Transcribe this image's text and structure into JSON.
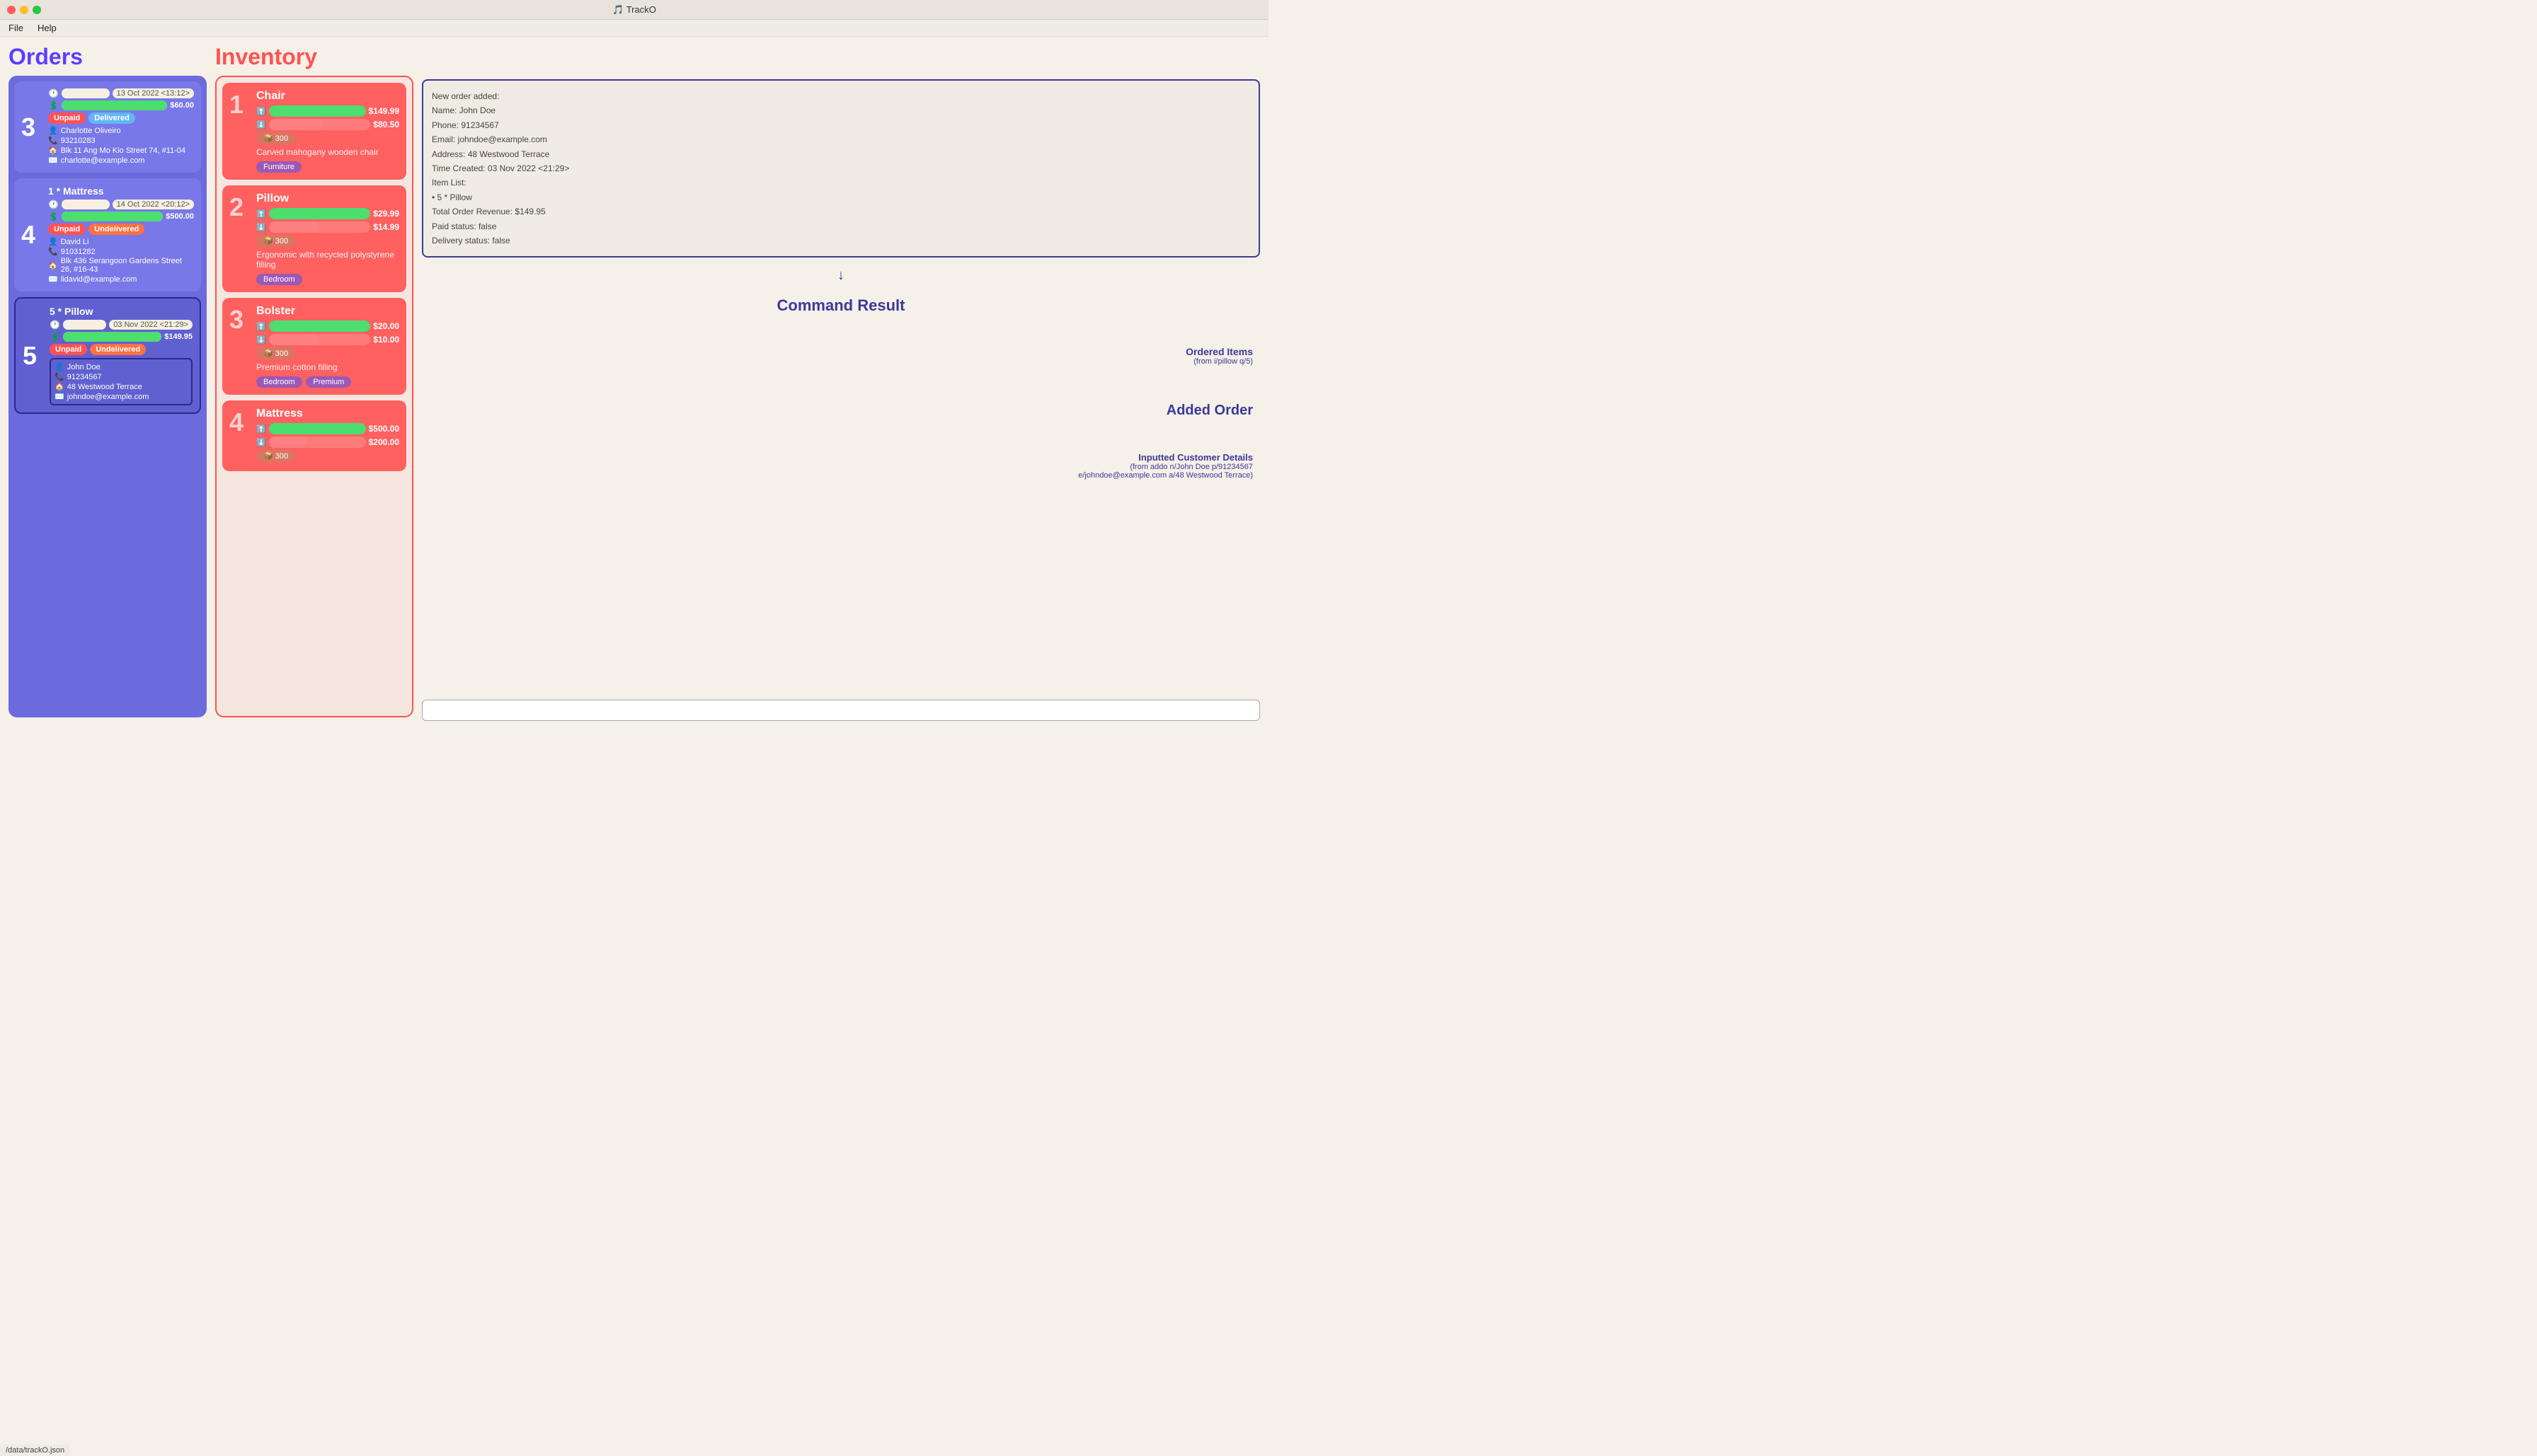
{
  "titlebar": {
    "title": "🎵 TrackO",
    "buttons": [
      "close",
      "minimize",
      "maximize"
    ]
  },
  "menubar": {
    "items": [
      "File",
      "Help"
    ]
  },
  "orders_title": "Orders",
  "inventory_title": "Inventory",
  "orders": [
    {
      "number": "3",
      "item_name": null,
      "date": "13 Oct 2022 <13:12>",
      "price": "$60.00",
      "badges": [
        "Unpaid",
        "Delivered"
      ],
      "badge_types": [
        "red",
        "blue"
      ],
      "name": "Charlotte Oliveiro",
      "phone": "93210283",
      "address": "Blk 11 Ang Mo Kio Street 74, #11-04",
      "email": "charlotte@example.com",
      "highlighted": false,
      "show_item_name": false
    },
    {
      "number": "4",
      "item_name": "1 * Mattress",
      "date": "14 Oct 2022 <20:12>",
      "price": "$500.00",
      "badges": [
        "Unpaid",
        "Undelivered"
      ],
      "badge_types": [
        "red",
        "orange"
      ],
      "name": "David Li",
      "phone": "91031282",
      "address": "Blk 436 Serangoon Gardens Street 26, #16-43",
      "email": "lidavid@example.com",
      "highlighted": false,
      "show_item_name": true
    },
    {
      "number": "5",
      "item_name": "5 * Pillow",
      "date": "03 Nov 2022 <21:29>",
      "price": "$149.95",
      "badges": [
        "Unpaid",
        "Undelivered"
      ],
      "badge_types": [
        "red",
        "orange"
      ],
      "name": "John Doe",
      "phone": "91234567",
      "address": "48 Westwood Terrace",
      "email": "johndoe@example.com",
      "highlighted": true,
      "show_item_name": true
    }
  ],
  "inventory_items": [
    {
      "number": "1",
      "name": "Chair",
      "sell_price": "$149.99",
      "cost_price": "$80.50",
      "stock": "300",
      "description": "Carved mahogany wooden chair",
      "tags": [
        "Furniture"
      ],
      "tag_types": [
        "purple"
      ],
      "sell_bar_pct": 100,
      "cost_bar_pct": 54
    },
    {
      "number": "2",
      "name": "Pillow",
      "sell_price": "$29.99",
      "cost_price": "$14.99",
      "stock": "300",
      "description": "Ergonomic with recycled polystyrene filling",
      "tags": [
        "Bedroom"
      ],
      "tag_types": [
        "purple"
      ],
      "sell_bar_pct": 100,
      "cost_bar_pct": 50
    },
    {
      "number": "3",
      "name": "Bolster",
      "sell_price": "$20.00",
      "cost_price": "$10.00",
      "stock": "300",
      "description": "Premium cotton filling",
      "tags": [
        "Bedroom",
        "Premium"
      ],
      "tag_types": [
        "purple",
        "purple"
      ],
      "sell_bar_pct": 100,
      "cost_bar_pct": 50
    },
    {
      "number": "4",
      "name": "Mattress",
      "sell_price": "$500.00",
      "cost_price": "$200.00",
      "stock": "300",
      "description": "",
      "tags": [],
      "tag_types": [],
      "sell_bar_pct": 100,
      "cost_bar_pct": 40
    }
  ],
  "command_result": {
    "title": "Command Result",
    "lines": [
      "New order added:",
      "Name: John Doe",
      "Phone: 91234567",
      "Email: johndoe@example.com",
      "Address: 48 Westwood Terrace",
      "Time Created: 03 Nov 2022 <21:29>",
      "Item List:",
      "• 5 * Pillow",
      "Total Order Revenue: $149.95",
      "Paid status: false",
      "Delivery status: false"
    ]
  },
  "annotations": {
    "ordered_items_title": "Ordered Items",
    "ordered_items_sub": "(from i/pillow q/5)",
    "added_order_title": "Added Order",
    "inputted_details_title": "Inputted Customer Details",
    "inputted_details_sub": "(from addo n/John Doe p/91234567\ne/johndoe@example.com a/48 Westwood Terrace)"
  },
  "statusbar": {
    "text": "/data/trackO.json"
  },
  "cmd_input": {
    "placeholder": ""
  }
}
